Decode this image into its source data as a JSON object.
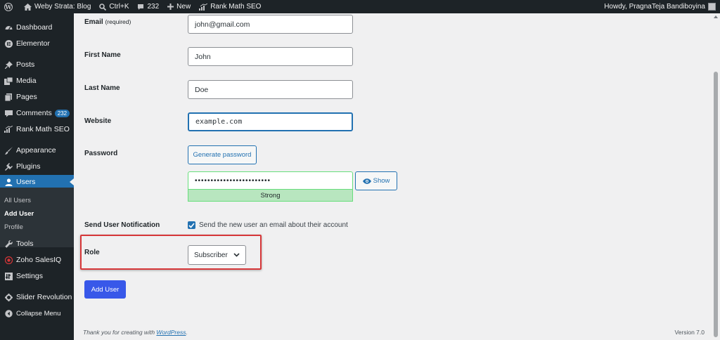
{
  "adminbar": {
    "site_name": "Weby Strata: Blog",
    "shortcut": "Ctrl+K",
    "comments_count": "232",
    "new_label": "New",
    "seo_label": "Rank Math SEO",
    "greeting": "Howdy, PragnaTeja Bandiboyina"
  },
  "sidebar": {
    "items": [
      {
        "label": "Dashboard",
        "icon": "dashboard-icon"
      },
      {
        "label": "Elementor",
        "icon": "elementor-icon"
      },
      {
        "label": "Posts",
        "icon": "pin-icon"
      },
      {
        "label": "Media",
        "icon": "media-icon"
      },
      {
        "label": "Pages",
        "icon": "pages-icon"
      },
      {
        "label": "Comments",
        "icon": "comment-icon",
        "badge": "232"
      },
      {
        "label": "Rank Math SEO",
        "icon": "chart-icon"
      },
      {
        "label": "Appearance",
        "icon": "brush-icon"
      },
      {
        "label": "Plugins",
        "icon": "plugin-icon"
      },
      {
        "label": "Users",
        "icon": "user-icon"
      },
      {
        "label": "Tools",
        "icon": "wrench-icon"
      },
      {
        "label": "Zoho SalesIQ",
        "icon": "zoho-icon"
      },
      {
        "label": "Settings",
        "icon": "settings-icon"
      },
      {
        "label": "Slider Revolution",
        "icon": "slider-icon"
      },
      {
        "label": "Collapse Menu",
        "icon": "collapse-icon"
      }
    ],
    "submenu": [
      "All Users",
      "Add User",
      "Profile"
    ]
  },
  "form": {
    "email_label": "Email",
    "email_required": "(required)",
    "email_value": "john@gmail.com",
    "first_name_label": "First Name",
    "first_name_value": "John",
    "last_name_label": "Last Name",
    "last_name_value": "Doe",
    "website_label": "Website",
    "website_value": "example.com",
    "password_label": "Password",
    "generate_password": "Generate password",
    "password_value": "••••••••••••••••••••••••",
    "show_label": "Show",
    "strength": "Strong",
    "notification_label": "Send User Notification",
    "notification_text": "Send the new user an email about their account",
    "role_label": "Role",
    "role_value": "Subscriber",
    "submit": "Add User"
  },
  "footer": {
    "thanks_prefix": "Thank you for creating with ",
    "thanks_link": "WordPress",
    "thanks_suffix": ".",
    "version": "Version 7.0"
  },
  "colors": {
    "adminbar_bg": "#1d2327",
    "accent": "#2271b1",
    "primary_button": "#3858e9",
    "highlight": "#d63638",
    "strength_bg": "#b8e6bf"
  }
}
